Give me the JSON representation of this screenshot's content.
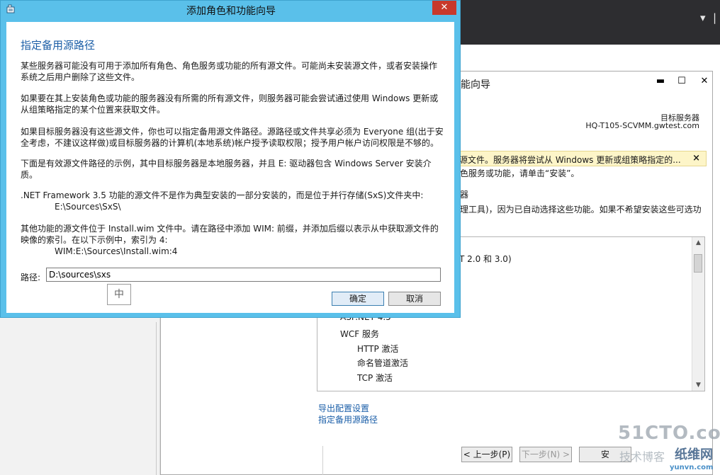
{
  "server_manager": {
    "dropdown_glyph": "▾",
    "tab_glyph": "|"
  },
  "background_wizard": {
    "title": "能向导",
    "window_buttons": {
      "minimize": "▬",
      "maximize": "☐",
      "close": "✕"
    },
    "destination_label": "目标服务器",
    "destination_name": "HQ-T105-SCVMM.gwtest.com",
    "warning_text": "源文件。服务器将尝试从 Windows 更新或组策略指定的...",
    "warning_close": "×",
    "install_hint": "色服务或功能，请单击“安装”。",
    "server_line": "器",
    "tools_line": "理工具)，因为已自动选择这些功能。如果不希望安装这些可选功",
    "features": {
      "f1": "T 2.0 和 3.0)",
      "f2": "ASP.NET 4.5",
      "f3": "WCF 服务",
      "f4": "HTTP 激活",
      "f5": "命名管道激活",
      "f6": "TCP 激活"
    },
    "links": {
      "export": "导出配置设置",
      "alt_source": "指定备用源路径"
    },
    "buttons": {
      "prev": "< 上一步(P)",
      "next": "下一步(N) >",
      "install": "安"
    }
  },
  "dialog": {
    "title": "添加角色和功能向导",
    "close_glyph": "✕",
    "heading": "指定备用源路径",
    "paragraphs": {
      "p1": [
        "某些服务器可能没有可用于添加所有角色、角色服务或功能的所有源文件。可能尚未安装源文件，或者安装操作",
        "系统之后用户删除了这些文件。"
      ],
      "p2": [
        "如果要在其上安装角色或功能的服务器没有所需的所有源文件，则服务器可能会尝试通过使用 Windows 更新或",
        "从组策略指定的某个位置来获取文件。"
      ],
      "p3": [
        "如果目标服务器没有这些源文件，你也可以指定备用源文件路径。源路径或文件共享必须为 Everyone 组(出于安",
        "全考虑，不建议这样做)或目标服务器的计算机(本地系统)帐户授予读取权限；授予用户帐户访问权限是不够的。"
      ],
      "p4": [
        "下面是有效源文件路径的示例，其中目标服务器是本地服务器，并且 E: 驱动器包含 Windows Server 安装介",
        "质。"
      ],
      "p5": [
        ".NET Framework 3.5 功能的源文件不是作为典型安装的一部分安装的，而是位于并行存储(SxS)文件夹中:",
        "E:\\Sources\\SxS\\"
      ],
      "p6": [
        "其他功能的源文件位于 Install.wim 文件中。请在路径中添加 WIM: 前缀，并添加后缀以表示从中获取源文件的",
        "映像的索引。在以下示例中，索引为 4:",
        "WIM:E:\\Sources\\Install.wim:4"
      ]
    },
    "path_label": "路径:",
    "path_value": "D:\\sources\\sxs",
    "ime_indicator": "中",
    "ok_label": "确定",
    "cancel_label": "取消"
  },
  "watermarks": {
    "w1": "51CTO.com",
    "w2": "技术博客",
    "w3": "纸维网",
    "w4": "yunvn.com"
  }
}
